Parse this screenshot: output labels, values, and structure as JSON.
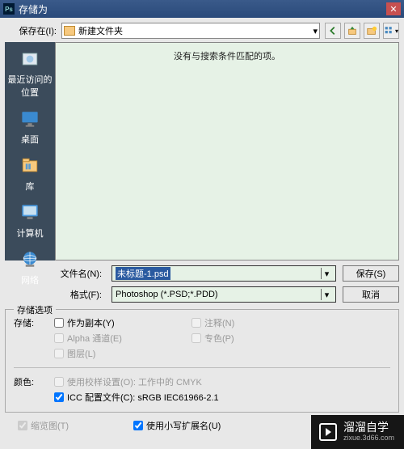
{
  "title": "存储为",
  "saveInLabel": "保存在(I):",
  "folderName": "新建文件夹",
  "places": [
    {
      "label": "最近访问的位置",
      "icon": "recent"
    },
    {
      "label": "桌面",
      "icon": "desktop"
    },
    {
      "label": "库",
      "icon": "library"
    },
    {
      "label": "计算机",
      "icon": "computer"
    },
    {
      "label": "网络",
      "icon": "network"
    }
  ],
  "emptyMessage": "没有与搜索条件匹配的项。",
  "fileNameLabel": "文件名(N):",
  "fileName": "未标题-1.psd",
  "formatLabel": "格式(F):",
  "format": "Photoshop (*.PSD;*.PDD)",
  "saveBtn": "保存(S)",
  "cancelBtn": "取消",
  "optionsLegend": "存储选项",
  "storeLabel": "存储:",
  "opts": {
    "copy": "作为副本(Y)",
    "alpha": "Alpha 通道(E)",
    "layers": "图层(L)",
    "notes": "注释(N)",
    "spot": "专色(P)"
  },
  "colorLabel": "颜色:",
  "proof": "使用校样设置(O): 工作中的 CMYK",
  "icc": "ICC 配置文件(C): sRGB IEC61966-2.1",
  "thumb": "缩览图(T)",
  "lowercase": "使用小写扩展名(U)",
  "watermark": {
    "cn": "溜溜自学",
    "en": "zixue.3d66.com"
  }
}
